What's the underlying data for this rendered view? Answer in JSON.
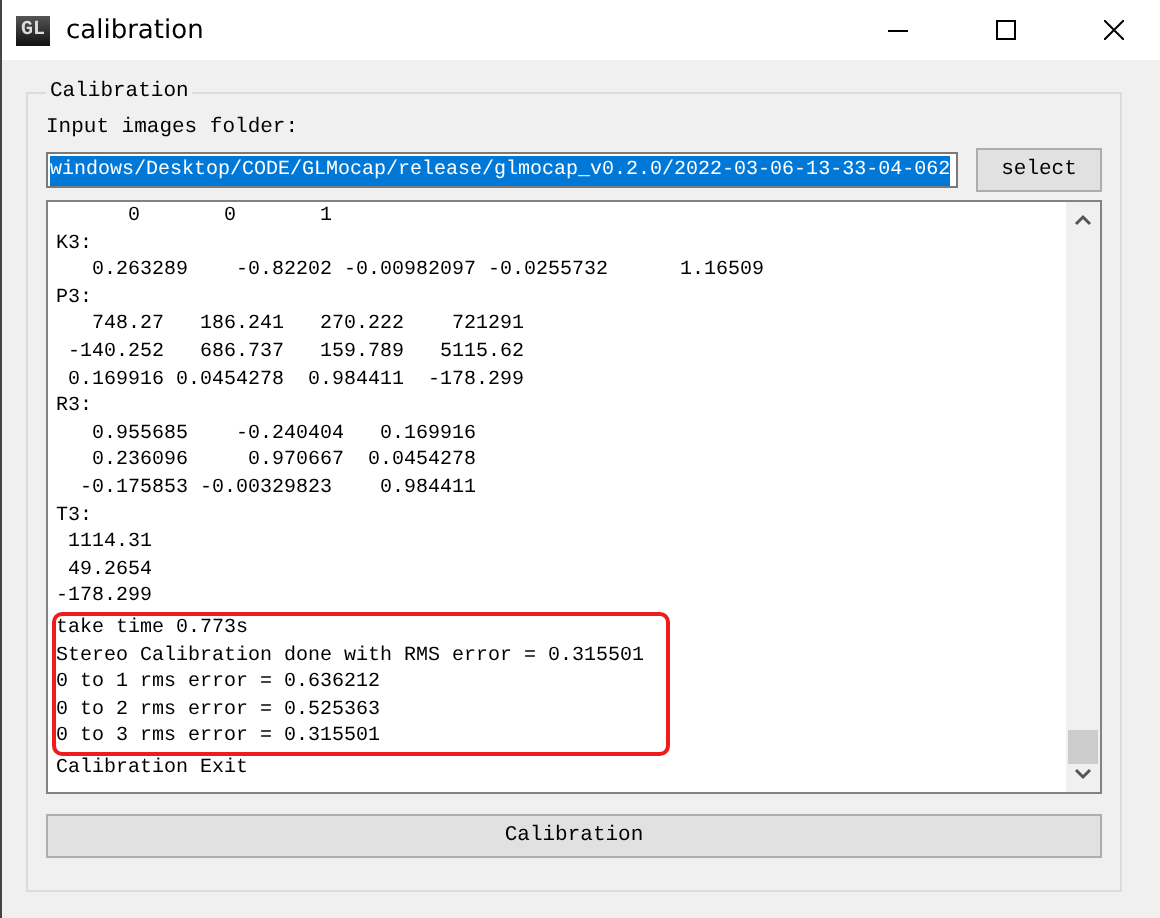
{
  "window": {
    "title": "calibration",
    "app_icon_text": "GL"
  },
  "group": {
    "title": "Calibration",
    "folder_label": "Input images folder:",
    "folder_field": {
      "value": "windows/Desktop/CODE/GLMocap/release/glmocap_v0.2.0/2022-03-06-13-33-04-062",
      "selected": true
    },
    "select_button": "select",
    "log_blocks": [
      {
        "highlighted": false,
        "lines": [
          "      0       0       1",
          "K3:",
          "   0.263289    -0.82202 -0.00982097 -0.0255732      1.16509",
          "P3:",
          "   748.27   186.241   270.222    721291",
          " -140.252   686.737   159.789   5115.62",
          " 0.169916 0.0454278  0.984411  -178.299",
          "R3:",
          "   0.955685    -0.240404   0.169916",
          "   0.236096     0.970667  0.0454278",
          "  -0.175853 -0.00329823    0.984411",
          "T3:",
          " 1114.31",
          " 49.2654",
          "-178.299"
        ]
      },
      {
        "highlighted": true,
        "lines": [
          "take time 0.773s",
          "Stereo Calibration done with RMS error = 0.315501",
          "0 to 1 rms error = 0.636212",
          "0 to 2 rms error = 0.525363",
          "0 to 3 rms error = 0.315501"
        ]
      },
      {
        "highlighted": false,
        "lines": [
          "Calibration Exit"
        ]
      }
    ],
    "calibration_button": "Calibration"
  }
}
